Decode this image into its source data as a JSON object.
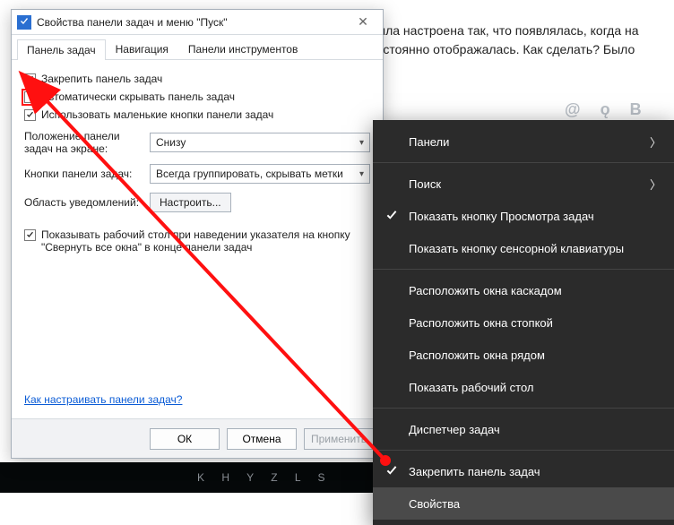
{
  "bg_text": "была настроена так, что появлялась, когда на постоянно отображалась. Как сделать? Было",
  "social": {
    "at": "@",
    "ok": "ǫ",
    "vk": "В"
  },
  "dialog": {
    "title": "Свойства панели задач и меню \"Пуск\"",
    "tabs": [
      "Панель задач",
      "Навигация",
      "Панели инструментов"
    ],
    "chk_lock": "Закрепить панель задач",
    "chk_autohide": "Автоматически скрывать панель задач",
    "chk_small": "Использовать маленькие кнопки панели задач",
    "pos_label": "Положение панели задач на экране:",
    "pos_value": "Снизу",
    "btn_label": "Кнопки панели задач:",
    "btn_value": "Всегда группировать, скрывать метки",
    "notif_label": "Область уведомлений:",
    "notif_btn": "Настроить...",
    "peek": "Показывать рабочий стол при наведении указателя на кнопку \"Свернуть все окна\" в конце панели задач",
    "help_link": "Как настраивать панели задач?",
    "ok": "ОК",
    "cancel": "Отмена",
    "apply": "Применить"
  },
  "ctx": {
    "panels": "Панели",
    "search": "Поиск",
    "taskview": "Показать кнопку Просмотра задач",
    "touchkb": "Показать кнопку сенсорной клавиатуры",
    "cascade": "Расположить окна каскадом",
    "stack": "Расположить окна стопкой",
    "side": "Расположить окна рядом",
    "desktop": "Показать рабочий стол",
    "taskmgr": "Диспетчер задач",
    "lock": "Закрепить панель задач",
    "props": "Свойства"
  },
  "bottom": "K   H   Y   Z   L     S"
}
